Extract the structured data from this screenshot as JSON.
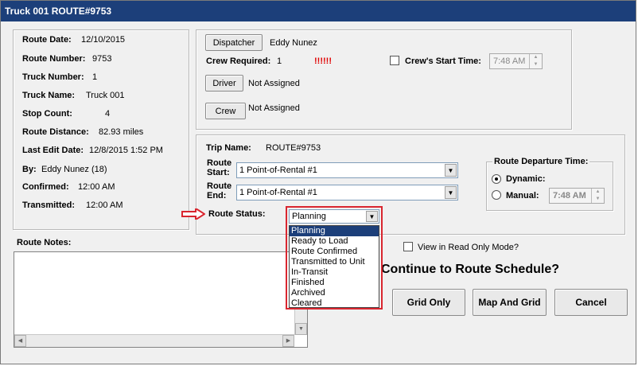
{
  "window": {
    "title": "Truck 001 ROUTE#9753"
  },
  "summary": {
    "route_date_label": "Route Date:",
    "route_date": "12/10/2015",
    "route_number_label": "Route Number:",
    "route_number": "9753",
    "truck_number_label": "Truck Number:",
    "truck_number": "1",
    "truck_name_label": "Truck Name:",
    "truck_name": "Truck 001",
    "stop_count_label": "Stop Count:",
    "stop_count": "4",
    "route_distance_label": "Route Distance:",
    "route_distance": "82.93 miles",
    "last_edit_label": "Last Edit Date:",
    "last_edit": "12/8/2015 1:52 PM",
    "by_label": "By:",
    "by": "Eddy Nunez (18)",
    "confirmed_label": "Confirmed:",
    "confirmed": "12:00 AM",
    "transmitted_label": "Transmitted:",
    "transmitted": "12:00 AM"
  },
  "crew": {
    "dispatcher_button": "Dispatcher",
    "dispatcher_name": "Eddy Nunez",
    "crew_required_label": "Crew Required:",
    "crew_required": "1",
    "warning": "!!!!!!",
    "start_time_label": "Crew's Start Time:",
    "start_time": "7:48 AM",
    "driver_button": "Driver",
    "driver_value": "Not Assigned",
    "crew_button": "Crew",
    "crew_value": "Not Assigned"
  },
  "trip": {
    "trip_name_label": "Trip Name:",
    "trip_name": "ROUTE#9753",
    "route_start_label_1": "Route",
    "route_start_label_2": "Start:",
    "route_start": "1 Point-of-Rental #1",
    "route_end_label_1": "Route",
    "route_end_label_2": "End:",
    "route_end": "1 Point-of-Rental #1",
    "route_status_label": "Route Status:",
    "route_status": "Planning",
    "departure_title": "Route Departure Time:",
    "dynamic_label": "Dynamic:",
    "manual_label": "Manual:",
    "manual_time": "7:48 AM"
  },
  "status_options": [
    "Planning",
    "Ready to Load",
    "Route Confirmed",
    "Transmitted to Unit",
    "In-Transit",
    "Finished",
    "Archived",
    "Cleared"
  ],
  "notes": {
    "label": "Route Notes:",
    "value": ""
  },
  "actions": {
    "read_only_label": "View in Read Only Mode?",
    "prompt": "Continue to Route Schedule?",
    "grid_only": "Grid Only",
    "map_and_grid": "Map And Grid",
    "cancel": "Cancel"
  },
  "colors": {
    "titlebar": "#1c3f7a",
    "highlight": "#d9262f",
    "warning": "#e00000"
  }
}
